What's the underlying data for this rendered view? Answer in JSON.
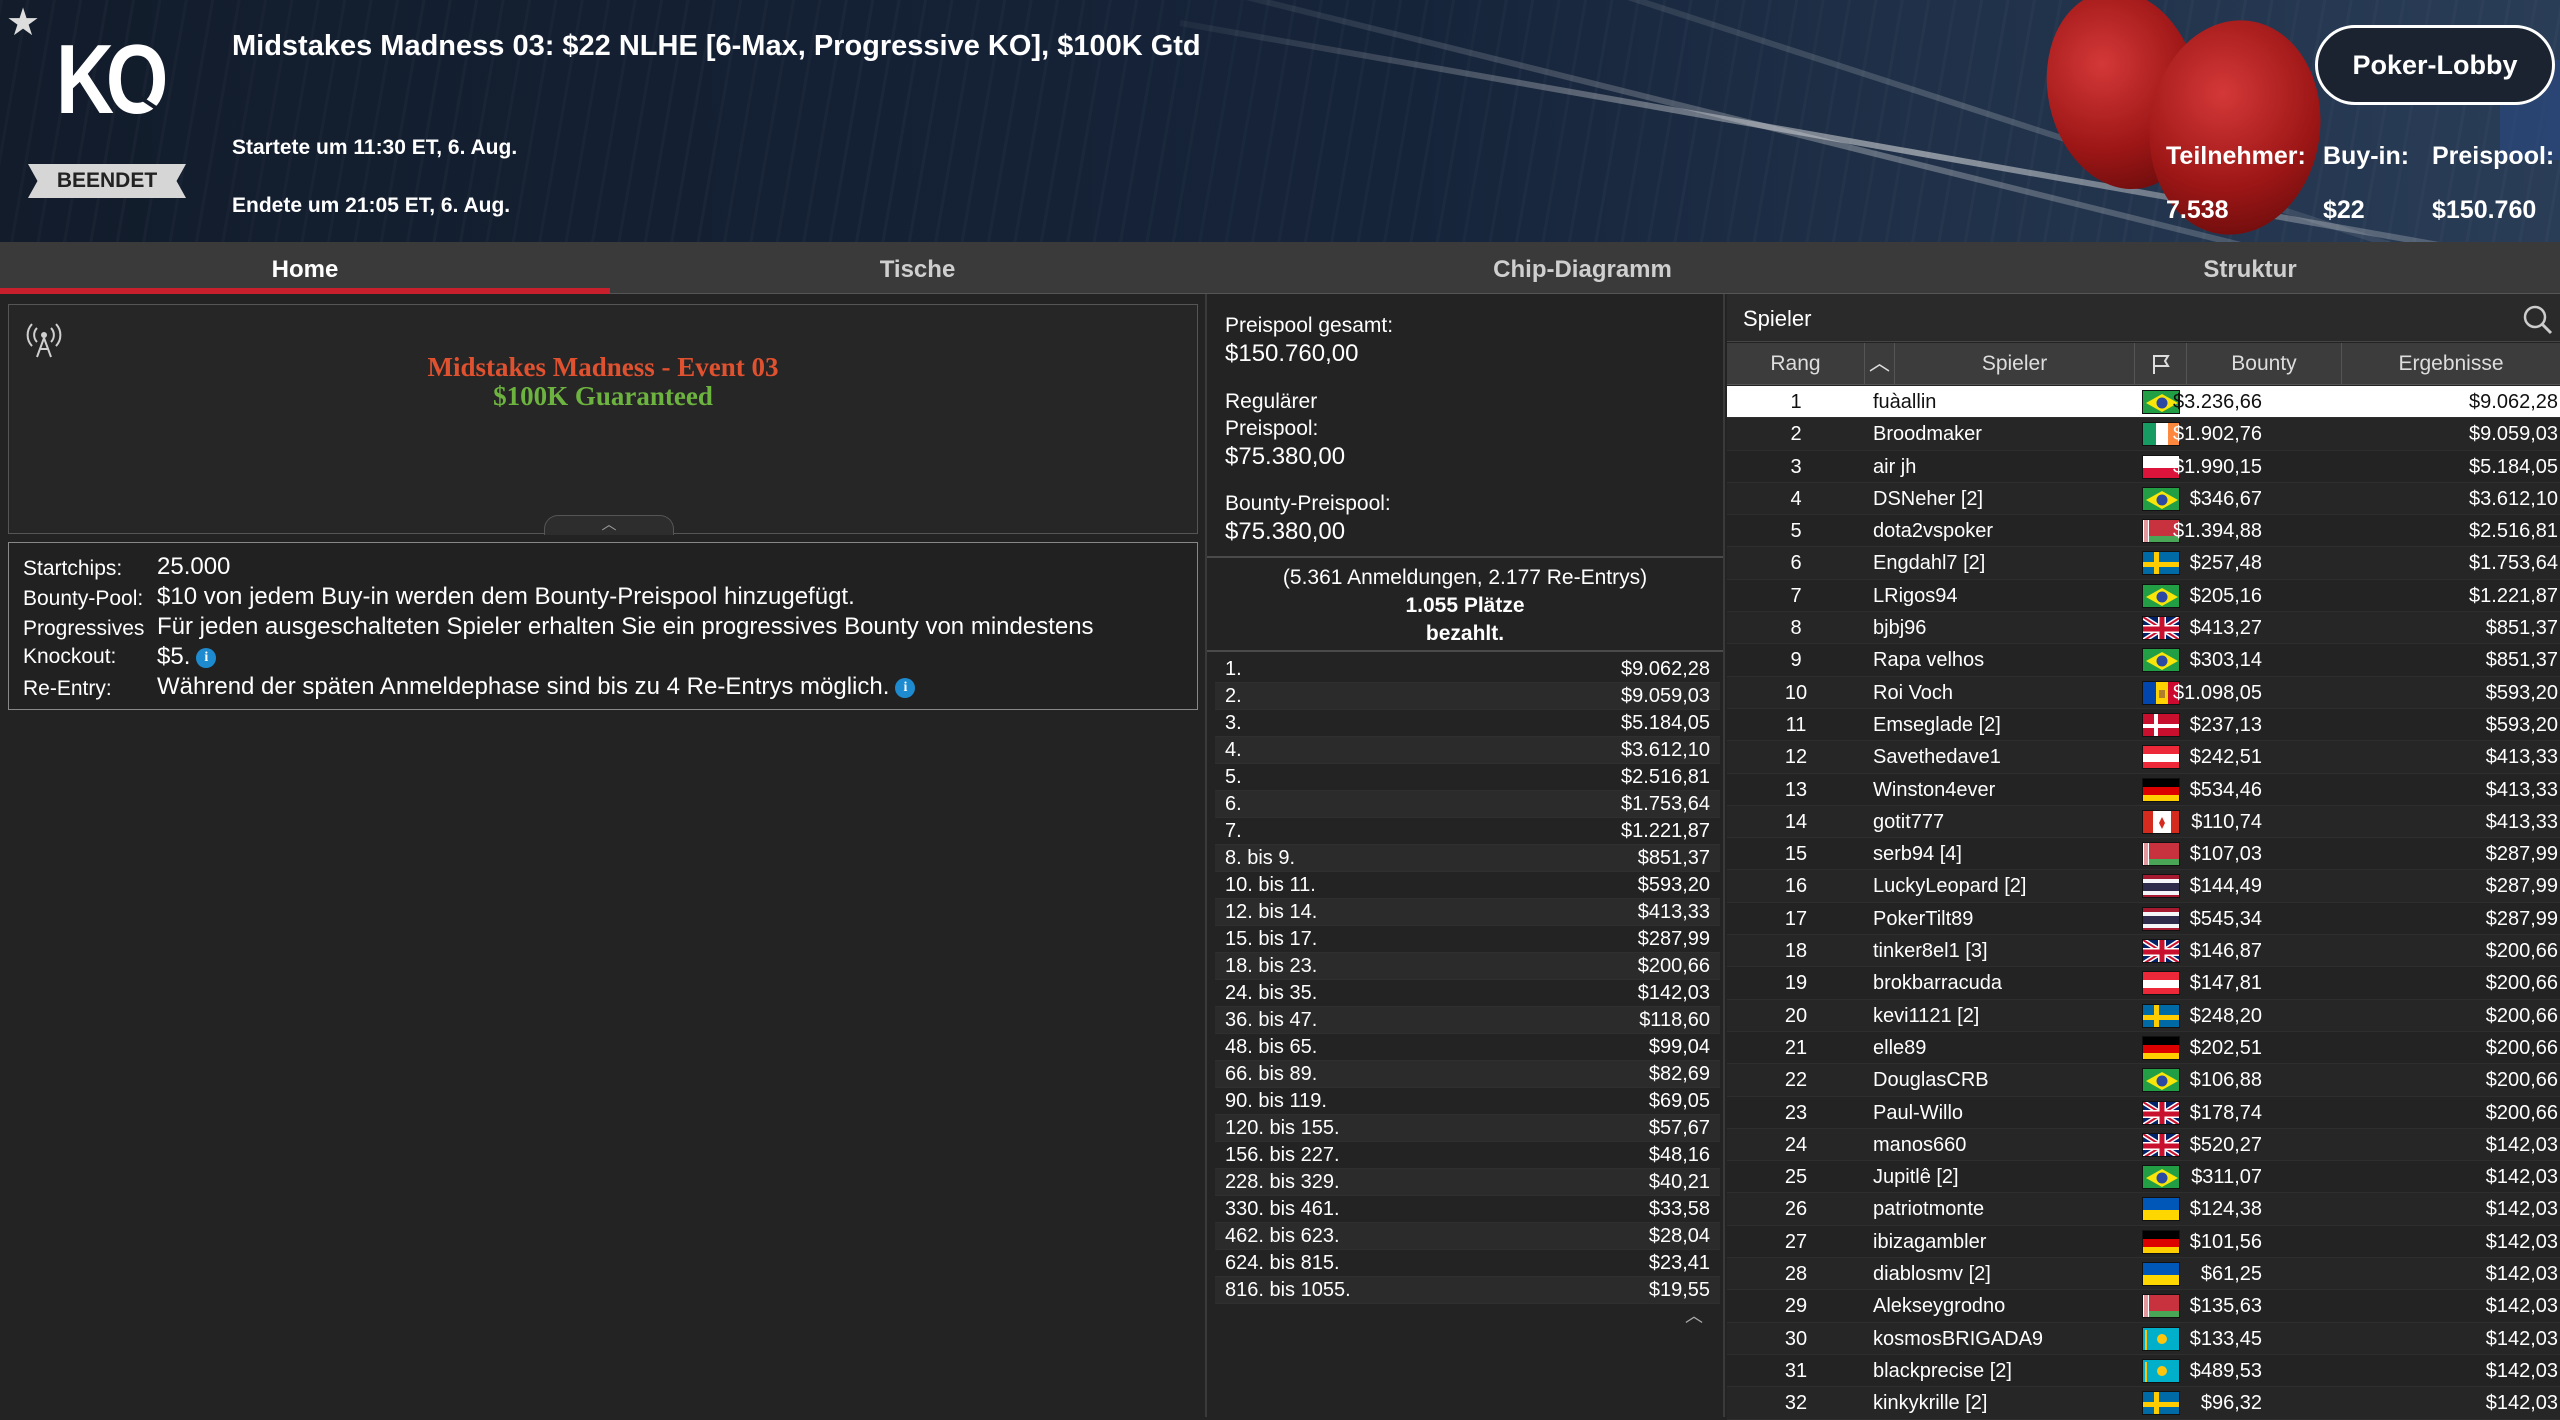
{
  "header": {
    "title": "Midstakes Madness 03: $22 NLHE [6-Max, Progressive KO], $100K Gtd",
    "logo_text": "KO",
    "status": "BEENDET",
    "start": "Startete um 11:30 ET, 6. Aug.",
    "end": "Endete um 21:05 ET, 6. Aug.",
    "lobby_button": "Poker-Lobby",
    "stats": {
      "participants_label": "Teilnehmer:",
      "participants_value": "7.538",
      "buyin_label": "Buy-in:",
      "buyin_value": "$22",
      "prizepool_label": "Preispool:",
      "prizepool_value": "$150.760"
    }
  },
  "tabs": [
    "Home",
    "Tische",
    "Chip-Diagramm",
    "Struktur"
  ],
  "active_tab": "Home",
  "banner": {
    "line1": "Midstakes Madness - Event 03",
    "line2": "$100K Guaranteed",
    "line1_color": "#e0512f",
    "line2_color": "#6db33f"
  },
  "info": {
    "startchips_label": "Startchips:",
    "startchips_value": "25.000",
    "bountypool_label": "Bounty-Pool:",
    "bountypool_value": "$10 von jedem Buy-in werden dem Bounty-Preispool hinzugefügt.",
    "pko_label_1": "Progressives",
    "pko_label_2": "Knockout:",
    "pko_value_1": "Für jeden ausgeschalteten Spieler erhalten Sie ein progressives Bounty von mindestens",
    "pko_value_2": "$5.",
    "reentry_label": "Re-Entry:",
    "reentry_value": "Während der späten Anmeldephase sind bis zu 4 Re-Entrys möglich."
  },
  "prizepool": {
    "total_label": "Preispool gesamt:",
    "total_value": "$150.760,00",
    "regular_label_1": "Regulärer",
    "regular_label_2": "Preispool:",
    "regular_value": "$75.380,00",
    "bounty_label": "Bounty-Preispool:",
    "bounty_value": "$75.380,00",
    "summary_1": "(5.361 Anmeldungen, 2.177 Re-Entrys)",
    "summary_2": "1.055 Plätze",
    "summary_3": "bezahlt."
  },
  "payouts": [
    {
      "place": "1.",
      "amount": "$9.062,28"
    },
    {
      "place": "2.",
      "amount": "$9.059,03"
    },
    {
      "place": "3.",
      "amount": "$5.184,05"
    },
    {
      "place": "4.",
      "amount": "$3.612,10"
    },
    {
      "place": "5.",
      "amount": "$2.516,81"
    },
    {
      "place": "6.",
      "amount": "$1.753,64"
    },
    {
      "place": "7.",
      "amount": "$1.221,87"
    },
    {
      "place": "8. bis 9.",
      "amount": "$851,37"
    },
    {
      "place": "10. bis 11.",
      "amount": "$593,20"
    },
    {
      "place": "12. bis 14.",
      "amount": "$413,33"
    },
    {
      "place": "15. bis 17.",
      "amount": "$287,99"
    },
    {
      "place": "18. bis 23.",
      "amount": "$200,66"
    },
    {
      "place": "24. bis 35.",
      "amount": "$142,03"
    },
    {
      "place": "36. bis 47.",
      "amount": "$118,60"
    },
    {
      "place": "48. bis 65.",
      "amount": "$99,04"
    },
    {
      "place": "66. bis 89.",
      "amount": "$82,69"
    },
    {
      "place": "90. bis 119.",
      "amount": "$69,05"
    },
    {
      "place": "120. bis 155.",
      "amount": "$57,67"
    },
    {
      "place": "156. bis 227.",
      "amount": "$48,16"
    },
    {
      "place": "228. bis 329.",
      "amount": "$40,21"
    },
    {
      "place": "330. bis 461.",
      "amount": "$33,58"
    },
    {
      "place": "462. bis 623.",
      "amount": "$28,04"
    },
    {
      "place": "624. bis 815.",
      "amount": "$23,41"
    },
    {
      "place": "816. bis 1055.",
      "amount": "$19,55"
    }
  ],
  "players_panel": {
    "search_label": "Spieler",
    "columns": {
      "rank": "Rang",
      "player": "Spieler",
      "bounty": "Bounty",
      "result": "Ergebnisse"
    },
    "rows": [
      {
        "rank": "1",
        "name": "fuàallin",
        "flag": "br",
        "bounty": "$3.236,66",
        "result": "$9.062,28"
      },
      {
        "rank": "2",
        "name": "Broodmaker",
        "flag": "ie",
        "bounty": "$1.902,76",
        "result": "$9.059,03"
      },
      {
        "rank": "3",
        "name": "air jh",
        "flag": "pl",
        "bounty": "$1.990,15",
        "result": "$5.184,05"
      },
      {
        "rank": "4",
        "name": "DSNeher [2]",
        "flag": "br",
        "bounty": "$346,67",
        "result": "$3.612,10"
      },
      {
        "rank": "5",
        "name": "dota2vspoker",
        "flag": "by",
        "bounty": "$1.394,88",
        "result": "$2.516,81"
      },
      {
        "rank": "6",
        "name": "Engdahl7 [2]",
        "flag": "se",
        "bounty": "$257,48",
        "result": "$1.753,64"
      },
      {
        "rank": "7",
        "name": "LRigos94",
        "flag": "br",
        "bounty": "$205,16",
        "result": "$1.221,87"
      },
      {
        "rank": "8",
        "name": "bjbj96",
        "flag": "gb",
        "bounty": "$413,27",
        "result": "$851,37"
      },
      {
        "rank": "9",
        "name": "Rapa velhos",
        "flag": "br",
        "bounty": "$303,14",
        "result": "$851,37"
      },
      {
        "rank": "10",
        "name": "Roi Voch",
        "flag": "md",
        "bounty": "$1.098,05",
        "result": "$593,20"
      },
      {
        "rank": "11",
        "name": "Emseglade [2]",
        "flag": "dk",
        "bounty": "$237,13",
        "result": "$593,20"
      },
      {
        "rank": "12",
        "name": "Savethedave1",
        "flag": "at",
        "bounty": "$242,51",
        "result": "$413,33"
      },
      {
        "rank": "13",
        "name": "Winston4ever",
        "flag": "de",
        "bounty": "$534,46",
        "result": "$413,33"
      },
      {
        "rank": "14",
        "name": "gotit777",
        "flag": "ca",
        "bounty": "$110,74",
        "result": "$413,33"
      },
      {
        "rank": "15",
        "name": "serb94 [4]",
        "flag": "by",
        "bounty": "$107,03",
        "result": "$287,99"
      },
      {
        "rank": "16",
        "name": "LuckyLeopard [2]",
        "flag": "th",
        "bounty": "$144,49",
        "result": "$287,99"
      },
      {
        "rank": "17",
        "name": "PokerTilt89",
        "flag": "th",
        "bounty": "$545,34",
        "result": "$287,99"
      },
      {
        "rank": "18",
        "name": "tinker8el1 [3]",
        "flag": "gb",
        "bounty": "$146,87",
        "result": "$200,66"
      },
      {
        "rank": "19",
        "name": "brokbarracuda",
        "flag": "at",
        "bounty": "$147,81",
        "result": "$200,66"
      },
      {
        "rank": "20",
        "name": "kevi1121 [2]",
        "flag": "se",
        "bounty": "$248,20",
        "result": "$200,66"
      },
      {
        "rank": "21",
        "name": "elle89",
        "flag": "de",
        "bounty": "$202,51",
        "result": "$200,66"
      },
      {
        "rank": "22",
        "name": "DouglasCRB",
        "flag": "br",
        "bounty": "$106,88",
        "result": "$200,66"
      },
      {
        "rank": "23",
        "name": "Paul-Willo",
        "flag": "gb",
        "bounty": "$178,74",
        "result": "$200,66"
      },
      {
        "rank": "24",
        "name": "manos660",
        "flag": "gb",
        "bounty": "$520,27",
        "result": "$142,03"
      },
      {
        "rank": "25",
        "name": "Jupitlê [2]",
        "flag": "br",
        "bounty": "$311,07",
        "result": "$142,03"
      },
      {
        "rank": "26",
        "name": "patriotmonte",
        "flag": "ua",
        "bounty": "$124,38",
        "result": "$142,03"
      },
      {
        "rank": "27",
        "name": "ibizagambler",
        "flag": "de",
        "bounty": "$101,56",
        "result": "$142,03"
      },
      {
        "rank": "28",
        "name": "diablosmv [2]",
        "flag": "ua",
        "bounty": "$61,25",
        "result": "$142,03"
      },
      {
        "rank": "29",
        "name": "Alekseygrodno",
        "flag": "by",
        "bounty": "$135,63",
        "result": "$142,03"
      },
      {
        "rank": "30",
        "name": "kosmosBRIGADA9",
        "flag": "kz",
        "bounty": "$133,45",
        "result": "$142,03"
      },
      {
        "rank": "31",
        "name": "blackprecise [2]",
        "flag": "kz",
        "bounty": "$489,53",
        "result": "$142,03"
      },
      {
        "rank": "32",
        "name": "kinkykrille [2]",
        "flag": "se",
        "bounty": "$96,32",
        "result": "$142,03"
      }
    ]
  },
  "colors": {
    "accent": "#c81f2d",
    "info_icon": "#1e8bd0"
  }
}
